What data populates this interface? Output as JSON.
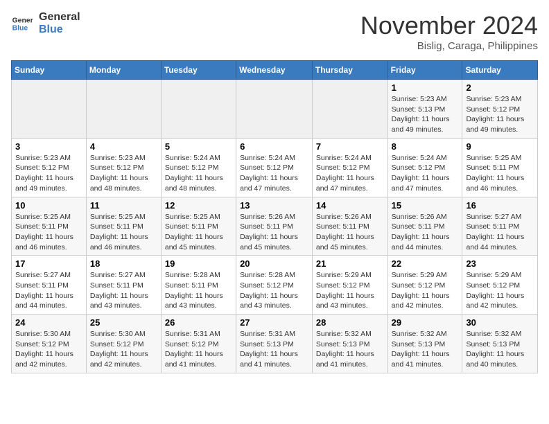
{
  "header": {
    "logo_line1": "General",
    "logo_line2": "Blue",
    "month": "November 2024",
    "location": "Bislig, Caraga, Philippines"
  },
  "weekdays": [
    "Sunday",
    "Monday",
    "Tuesday",
    "Wednesday",
    "Thursday",
    "Friday",
    "Saturday"
  ],
  "weeks": [
    [
      {
        "day": "",
        "sunrise": "",
        "sunset": "",
        "daylight": ""
      },
      {
        "day": "",
        "sunrise": "",
        "sunset": "",
        "daylight": ""
      },
      {
        "day": "",
        "sunrise": "",
        "sunset": "",
        "daylight": ""
      },
      {
        "day": "",
        "sunrise": "",
        "sunset": "",
        "daylight": ""
      },
      {
        "day": "",
        "sunrise": "",
        "sunset": "",
        "daylight": ""
      },
      {
        "day": "1",
        "sunrise": "Sunrise: 5:23 AM",
        "sunset": "Sunset: 5:13 PM",
        "daylight": "Daylight: 11 hours and 49 minutes."
      },
      {
        "day": "2",
        "sunrise": "Sunrise: 5:23 AM",
        "sunset": "Sunset: 5:12 PM",
        "daylight": "Daylight: 11 hours and 49 minutes."
      }
    ],
    [
      {
        "day": "3",
        "sunrise": "Sunrise: 5:23 AM",
        "sunset": "Sunset: 5:12 PM",
        "daylight": "Daylight: 11 hours and 49 minutes."
      },
      {
        "day": "4",
        "sunrise": "Sunrise: 5:23 AM",
        "sunset": "Sunset: 5:12 PM",
        "daylight": "Daylight: 11 hours and 48 minutes."
      },
      {
        "day": "5",
        "sunrise": "Sunrise: 5:24 AM",
        "sunset": "Sunset: 5:12 PM",
        "daylight": "Daylight: 11 hours and 48 minutes."
      },
      {
        "day": "6",
        "sunrise": "Sunrise: 5:24 AM",
        "sunset": "Sunset: 5:12 PM",
        "daylight": "Daylight: 11 hours and 47 minutes."
      },
      {
        "day": "7",
        "sunrise": "Sunrise: 5:24 AM",
        "sunset": "Sunset: 5:12 PM",
        "daylight": "Daylight: 11 hours and 47 minutes."
      },
      {
        "day": "8",
        "sunrise": "Sunrise: 5:24 AM",
        "sunset": "Sunset: 5:12 PM",
        "daylight": "Daylight: 11 hours and 47 minutes."
      },
      {
        "day": "9",
        "sunrise": "Sunrise: 5:25 AM",
        "sunset": "Sunset: 5:11 PM",
        "daylight": "Daylight: 11 hours and 46 minutes."
      }
    ],
    [
      {
        "day": "10",
        "sunrise": "Sunrise: 5:25 AM",
        "sunset": "Sunset: 5:11 PM",
        "daylight": "Daylight: 11 hours and 46 minutes."
      },
      {
        "day": "11",
        "sunrise": "Sunrise: 5:25 AM",
        "sunset": "Sunset: 5:11 PM",
        "daylight": "Daylight: 11 hours and 46 minutes."
      },
      {
        "day": "12",
        "sunrise": "Sunrise: 5:25 AM",
        "sunset": "Sunset: 5:11 PM",
        "daylight": "Daylight: 11 hours and 45 minutes."
      },
      {
        "day": "13",
        "sunrise": "Sunrise: 5:26 AM",
        "sunset": "Sunset: 5:11 PM",
        "daylight": "Daylight: 11 hours and 45 minutes."
      },
      {
        "day": "14",
        "sunrise": "Sunrise: 5:26 AM",
        "sunset": "Sunset: 5:11 PM",
        "daylight": "Daylight: 11 hours and 45 minutes."
      },
      {
        "day": "15",
        "sunrise": "Sunrise: 5:26 AM",
        "sunset": "Sunset: 5:11 PM",
        "daylight": "Daylight: 11 hours and 44 minutes."
      },
      {
        "day": "16",
        "sunrise": "Sunrise: 5:27 AM",
        "sunset": "Sunset: 5:11 PM",
        "daylight": "Daylight: 11 hours and 44 minutes."
      }
    ],
    [
      {
        "day": "17",
        "sunrise": "Sunrise: 5:27 AM",
        "sunset": "Sunset: 5:11 PM",
        "daylight": "Daylight: 11 hours and 44 minutes."
      },
      {
        "day": "18",
        "sunrise": "Sunrise: 5:27 AM",
        "sunset": "Sunset: 5:11 PM",
        "daylight": "Daylight: 11 hours and 43 minutes."
      },
      {
        "day": "19",
        "sunrise": "Sunrise: 5:28 AM",
        "sunset": "Sunset: 5:11 PM",
        "daylight": "Daylight: 11 hours and 43 minutes."
      },
      {
        "day": "20",
        "sunrise": "Sunrise: 5:28 AM",
        "sunset": "Sunset: 5:12 PM",
        "daylight": "Daylight: 11 hours and 43 minutes."
      },
      {
        "day": "21",
        "sunrise": "Sunrise: 5:29 AM",
        "sunset": "Sunset: 5:12 PM",
        "daylight": "Daylight: 11 hours and 43 minutes."
      },
      {
        "day": "22",
        "sunrise": "Sunrise: 5:29 AM",
        "sunset": "Sunset: 5:12 PM",
        "daylight": "Daylight: 11 hours and 42 minutes."
      },
      {
        "day": "23",
        "sunrise": "Sunrise: 5:29 AM",
        "sunset": "Sunset: 5:12 PM",
        "daylight": "Daylight: 11 hours and 42 minutes."
      }
    ],
    [
      {
        "day": "24",
        "sunrise": "Sunrise: 5:30 AM",
        "sunset": "Sunset: 5:12 PM",
        "daylight": "Daylight: 11 hours and 42 minutes."
      },
      {
        "day": "25",
        "sunrise": "Sunrise: 5:30 AM",
        "sunset": "Sunset: 5:12 PM",
        "daylight": "Daylight: 11 hours and 42 minutes."
      },
      {
        "day": "26",
        "sunrise": "Sunrise: 5:31 AM",
        "sunset": "Sunset: 5:12 PM",
        "daylight": "Daylight: 11 hours and 41 minutes."
      },
      {
        "day": "27",
        "sunrise": "Sunrise: 5:31 AM",
        "sunset": "Sunset: 5:13 PM",
        "daylight": "Daylight: 11 hours and 41 minutes."
      },
      {
        "day": "28",
        "sunrise": "Sunrise: 5:32 AM",
        "sunset": "Sunset: 5:13 PM",
        "daylight": "Daylight: 11 hours and 41 minutes."
      },
      {
        "day": "29",
        "sunrise": "Sunrise: 5:32 AM",
        "sunset": "Sunset: 5:13 PM",
        "daylight": "Daylight: 11 hours and 41 minutes."
      },
      {
        "day": "30",
        "sunrise": "Sunrise: 5:32 AM",
        "sunset": "Sunset: 5:13 PM",
        "daylight": "Daylight: 11 hours and 40 minutes."
      }
    ]
  ]
}
